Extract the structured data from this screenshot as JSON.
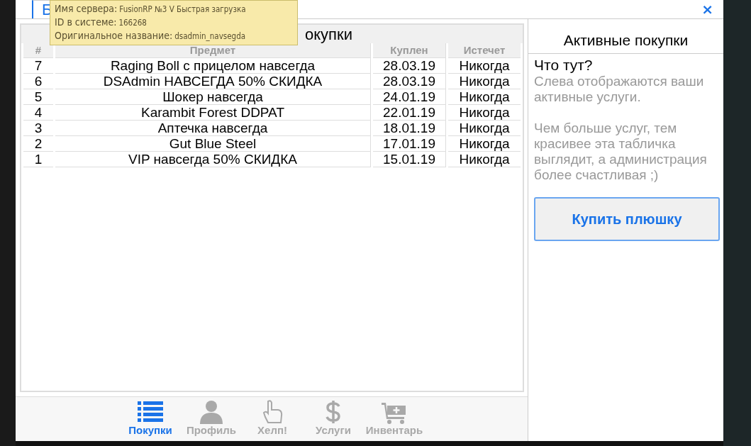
{
  "tab": {
    "label": "Б",
    "selected": true
  },
  "close": "×",
  "tooltip": [
    {
      "label": "Имя сервера:",
      "value": "FusionRP №3 V Быстрая загрузка"
    },
    {
      "label": "ID в системе:",
      "value": "166268"
    },
    {
      "label": "Оригинальное название:",
      "value": "dsadmin_navsegda"
    }
  ],
  "table": {
    "title": "окупки",
    "columns": [
      "#",
      "Предмет",
      "Куплен",
      "Истечет"
    ],
    "rows": [
      [
        "7",
        "Raging Boll с прицелом навсегда",
        "28.03.19",
        "Никогда"
      ],
      [
        "6",
        "DSAdmin НАВСЕГДА 50% СКИДКА",
        "28.03.19",
        "Никогда"
      ],
      [
        "5",
        "Шокер навсегда",
        "24.01.19",
        "Никогда"
      ],
      [
        "4",
        "Karambit Forest DDPAT",
        "22.01.19",
        "Никогда"
      ],
      [
        "3",
        "Аптечка навсегда",
        "18.01.19",
        "Никогда"
      ],
      [
        "2",
        "Gut Blue Steel",
        "17.01.19",
        "Никогда"
      ],
      [
        "1",
        "VIP навсегда 50% СКИДКА",
        "15.01.19",
        "Никогда"
      ]
    ]
  },
  "side": {
    "title": "Активные покупки",
    "heading": "Что тут?",
    "paragraphs": [
      "Слева отображаются ваши активные услуги.",
      "Чем больше услуг, тем красивее эта табличка выглядит, а администрация более счастливая ;)"
    ],
    "button": "Купить плюшку"
  },
  "nav": [
    {
      "label": "Покупки",
      "selected": true
    },
    {
      "label": "Профиль",
      "selected": false
    },
    {
      "label": "Хелп!",
      "selected": false
    },
    {
      "label": "Услуги",
      "selected": false
    },
    {
      "label": "Инвентарь",
      "selected": false
    }
  ]
}
